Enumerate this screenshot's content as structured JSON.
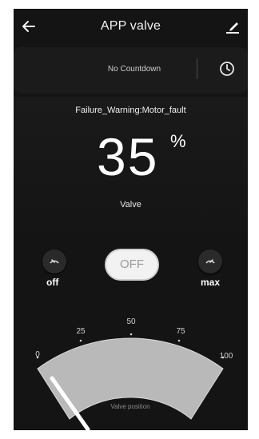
{
  "header": {
    "title": "APP  valve",
    "back_icon": "arrow-left-icon",
    "edit_icon": "edit-pen-icon"
  },
  "countdown": {
    "label": "No Countdown",
    "icon": "clock-icon"
  },
  "status": {
    "warning": "Failure_Warning:Motor_fault",
    "value": "35",
    "unit": "%",
    "label": "Valve"
  },
  "controls": {
    "off_label": "off",
    "max_label": "max",
    "toggle_label": "OFF"
  },
  "gauge": {
    "ticks": [
      "0",
      "25",
      "50",
      "75",
      "100"
    ],
    "caption": "Valve position",
    "position_percent": 0
  },
  "colors": {
    "background": "#141414",
    "toggle_bg": "#f2f2f2",
    "gauge_arc": "#bdbdbd"
  }
}
